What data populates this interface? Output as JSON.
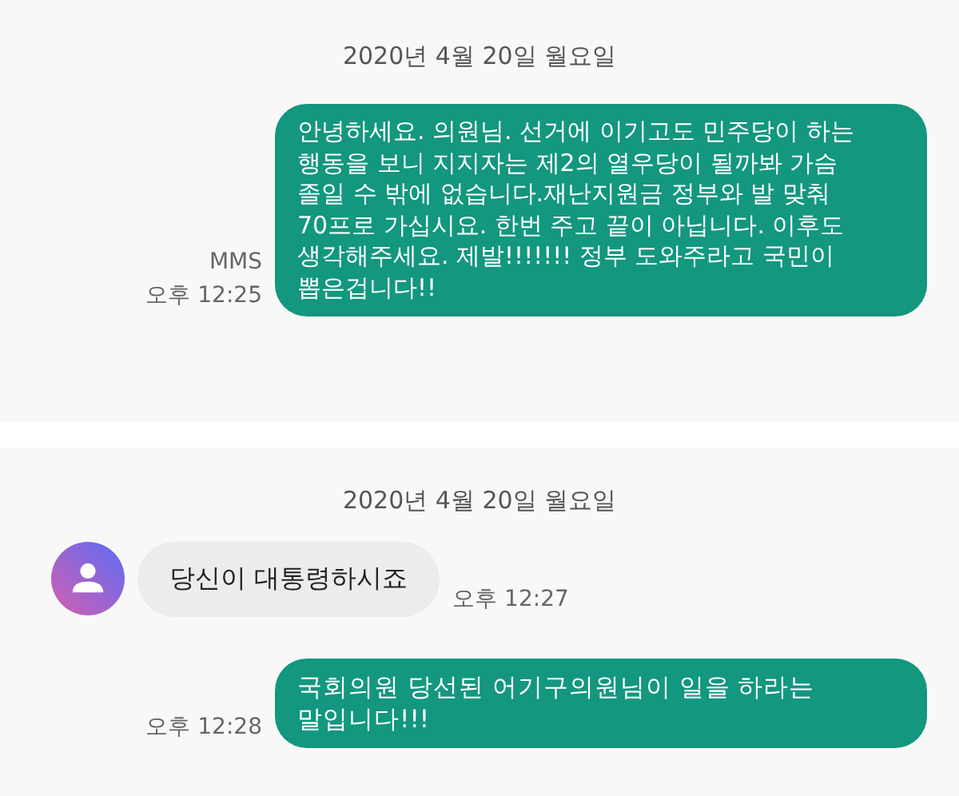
{
  "panels": [
    {
      "date": "2020년 4월 20일 월요일",
      "messages": [
        {
          "kind": "sent",
          "text": "안녕하세요. 의원님. 선거에 이기고도 민주당이 하는\n행동을 보니 지지자는 제2의 열우당이 될까봐 가슴\n졸일 수 밖에 없습니다.재난지원금 정부와 발 맞춰\n70프로 가십시요. 한번 주고 끝이 아닙니다. 이후도\n생각해주세요. 제발!!!!!!! 정부 도와주라고 국민이\n뽑은겁니다!!",
          "type": "MMS",
          "time": "오후 12:25"
        }
      ]
    },
    {
      "date": "2020년 4월 20일 월요일",
      "messages": [
        {
          "kind": "received",
          "text": "당신이 대통령하시죠",
          "time": "오후 12:27"
        },
        {
          "kind": "sent",
          "text": "국회의원 당선된 어기구의원님이 일을 하라는\n말입니다!!!",
          "time": "오후 12:28"
        }
      ]
    }
  ]
}
